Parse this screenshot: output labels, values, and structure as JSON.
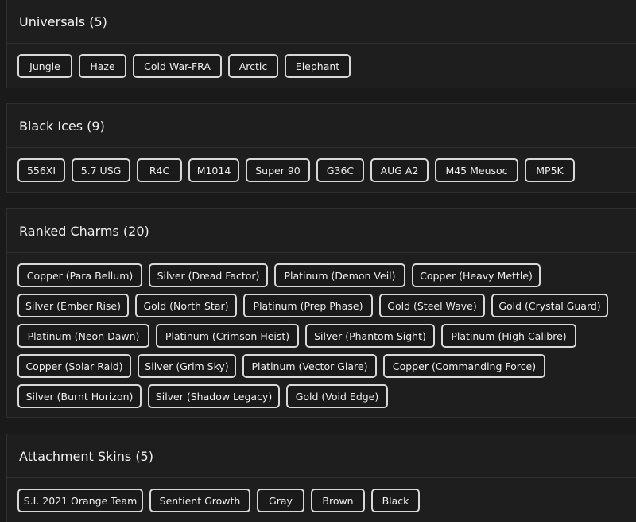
{
  "sections": [
    {
      "title": "Universals (5)",
      "rows": [
        [
          "Jungle",
          "Haze",
          "Cold War-FRA",
          "Arctic",
          "Elephant"
        ]
      ]
    },
    {
      "title": "Black Ices (9)",
      "rows": [
        [
          "556XI",
          "5.7 USG",
          "R4C",
          "M1014",
          "Super 90",
          "G36C",
          "AUG A2",
          "M45 Meusoc",
          "MP5K"
        ]
      ]
    },
    {
      "title": "Ranked Charms (20)",
      "rows": [
        [
          "Copper (Para Bellum)",
          "Silver (Dread Factor)",
          "Platinum (Demon Veil)",
          "Copper (Heavy Mettle)"
        ],
        [
          "Silver (Ember Rise)",
          "Gold (North Star)",
          "Platinum (Prep Phase)",
          "Gold (Steel Wave)",
          "Gold (Crystal Guard)"
        ],
        [
          "Platinum (Neon Dawn)",
          "Platinum (Crimson Heist)",
          "Silver (Phantom Sight)",
          "Platinum (High Calibre)"
        ],
        [
          "Copper (Solar Raid)",
          "Silver (Grim Sky)",
          "Platinum (Vector Glare)",
          "Copper (Commanding Force)"
        ],
        [
          "Silver (Burnt Horizon)",
          "Silver (Shadow Legacy)",
          "Gold (Void Edge)"
        ]
      ]
    },
    {
      "title": "Attachment Skins (5)",
      "rows": [
        [
          "S.I. 2021 Orange Team",
          "Sentient Growth",
          "Gray",
          "Brown",
          "Black"
        ]
      ]
    }
  ]
}
